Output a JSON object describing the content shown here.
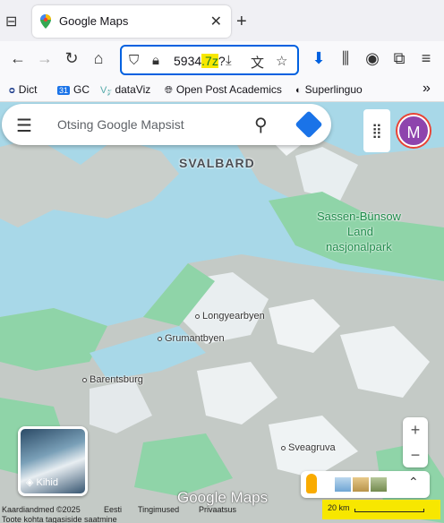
{
  "browser": {
    "tab_title": "Google Maps",
    "url_fragment": "5934",
    "url_highlight": ".7z",
    "url_tail": "?"
  },
  "bookmarks": [
    {
      "label": "Dict",
      "icon": "dict-icon"
    },
    {
      "label": "GC",
      "icon": "calendar-icon"
    },
    {
      "label": "dataViz",
      "icon": "viz-icon"
    },
    {
      "label": "Open Post Academics",
      "icon": "globe-icon"
    },
    {
      "label": "Superlinguo",
      "icon": "superlinguo-icon"
    }
  ],
  "search": {
    "placeholder": "Otsing Google Mapsist"
  },
  "avatar_letter": "M",
  "map_labels": {
    "region": "SVALBARD",
    "park_1": "Sassen-Bünsow",
    "park_2": "Land",
    "park_3": "nasjonalpark",
    "city_1": "Longyearbyen",
    "city_2": "Grumantbyen",
    "city_3": "Barentsburg",
    "city_4": "Sveagruva"
  },
  "layers_label": "Kihid",
  "zoom": {
    "in": "+",
    "out": "−"
  },
  "footer": {
    "data": "Kaardiandmed ©2025",
    "lang": "Eesti",
    "terms": "Tingimused",
    "privacy": "Privaatsus",
    "feedback": "Toote kohta tagasiside saatmine",
    "scale": "20 km",
    "logo": "Google Maps"
  },
  "colors": {
    "water": "#a8d8e8",
    "land_green": "#8fd4a8",
    "land_grey": "#c8c8c8",
    "accent_blue": "#1a73e8",
    "highlight_yellow": "#f7e700"
  }
}
